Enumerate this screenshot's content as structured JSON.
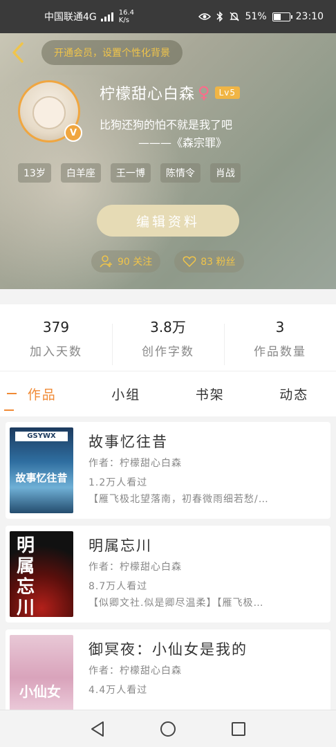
{
  "status_bar": {
    "carrier": "中国联通4G",
    "speed_value": "16.4",
    "speed_unit": "K/s",
    "battery_percent": "51%",
    "battery_level": 0.51,
    "time": "23:10"
  },
  "header": {
    "vip_banner": "开通会员，设置个性化背景",
    "username": "柠檬甜心白森",
    "gender_symbol": "♀",
    "level": "Lv5",
    "verify_badge": "V",
    "bio_line1": "比狗还狗的怕不就是我了吧",
    "bio_line2": "———《森宗罪》",
    "tags": [
      "13岁",
      "白羊座",
      "王一博",
      "陈情令",
      "肖战"
    ],
    "edit_button": "编辑资料",
    "following": "90 关注",
    "followers": "83 粉丝"
  },
  "stats": [
    {
      "value": "379",
      "label": "加入天数"
    },
    {
      "value": "3.8万",
      "label": "创作字数"
    },
    {
      "value": "3",
      "label": "作品数量"
    }
  ],
  "tabs": [
    {
      "label": "作品",
      "active": true
    },
    {
      "label": "小组",
      "active": false
    },
    {
      "label": "书架",
      "active": false
    },
    {
      "label": "动态",
      "active": false
    }
  ],
  "works": [
    {
      "title": "故事忆往昔",
      "author": "作者：柠檬甜心白森",
      "views": "1.2万人看过",
      "quote": "【雁飞极北望落南，初春微雨细若愁/…",
      "cover_top": "GSYWX",
      "cover_title": "故事忆往昔"
    },
    {
      "title": "明属忘川",
      "author": "作者：柠檬甜心白森",
      "views": "8.7万人看过",
      "quote": "【似卿文社.似是卿尽温柔】【雁飞极…",
      "cover_title": "明属忘川"
    },
    {
      "title": "御冥夜：小仙女是我的",
      "author": "作者：柠檬甜心白森",
      "views": "4.4万人看过",
      "quote": "",
      "cover_title": "小仙女"
    }
  ],
  "colors": {
    "accent": "#f08a35",
    "gold": "#f0c44a",
    "avatar_ring": "#f0a640"
  },
  "icons": {
    "back": "chevron-left-icon",
    "eye": "eye-icon",
    "bluetooth": "bluetooth-icon",
    "mute": "bell-off-icon",
    "battery": "battery-icon",
    "add_follow": "user-plus-icon",
    "heart": "heart-icon",
    "nav_back": "triangle-back-icon",
    "nav_home": "circle-home-icon",
    "nav_recent": "square-recent-icon"
  }
}
